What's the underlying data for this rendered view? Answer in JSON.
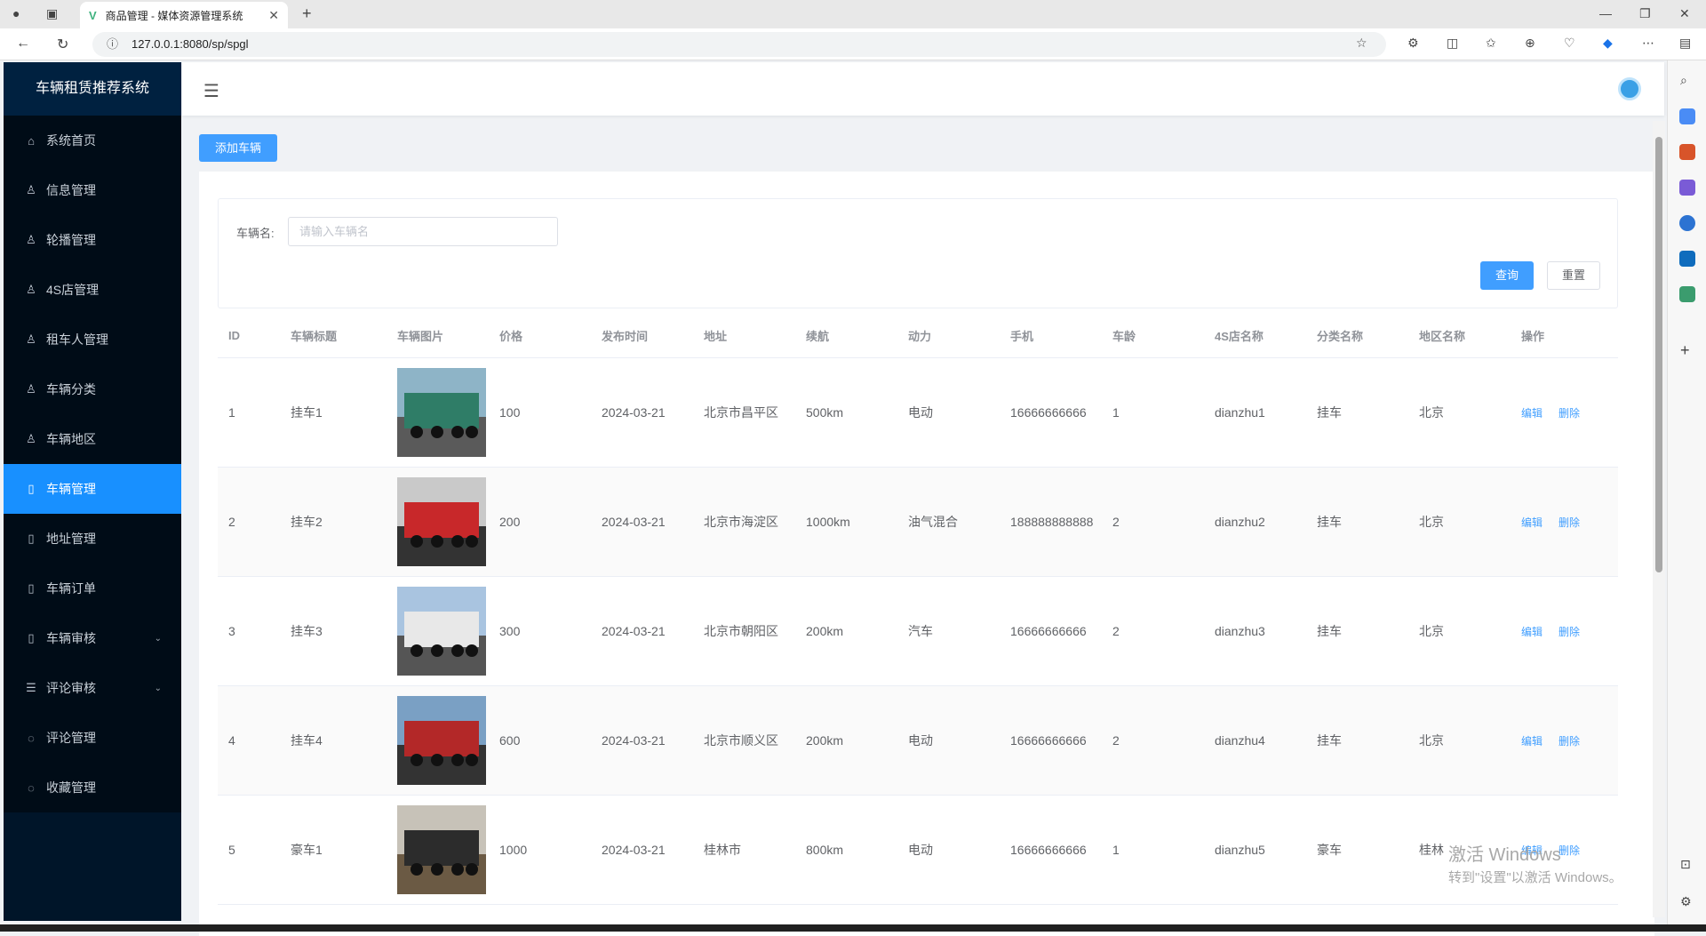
{
  "browser": {
    "tab_title": "商品管理 - 媒体资源管理系统",
    "url": "127.0.0.1:8080/sp/spgl"
  },
  "sidebar": {
    "brand": "车辆租赁推荐系统",
    "items": [
      {
        "label": "系统首页",
        "icon": "home-icon"
      },
      {
        "label": "信息管理",
        "icon": "user-icon"
      },
      {
        "label": "轮播管理",
        "icon": "user-icon"
      },
      {
        "label": "4S店管理",
        "icon": "user-icon"
      },
      {
        "label": "租车人管理",
        "icon": "user-icon"
      },
      {
        "label": "车辆分类",
        "icon": "user-icon"
      },
      {
        "label": "车辆地区",
        "icon": "user-icon"
      },
      {
        "label": "车辆管理",
        "icon": "document-icon"
      },
      {
        "label": "地址管理",
        "icon": "document-icon"
      },
      {
        "label": "车辆订单",
        "icon": "document-icon"
      },
      {
        "label": "车辆审核",
        "icon": "document-icon"
      },
      {
        "label": "评论审核",
        "icon": "list-icon"
      },
      {
        "label": "评论管理",
        "icon": "comment-icon"
      },
      {
        "label": "收藏管理",
        "icon": "comment-icon"
      }
    ],
    "active_index": 7
  },
  "toolbar": {
    "add_label": "添加车辆"
  },
  "search": {
    "label": "车辆名:",
    "placeholder": "请输入车辆名",
    "query_label": "查询",
    "reset_label": "重置"
  },
  "table": {
    "columns": [
      "ID",
      "车辆标题",
      "车辆图片",
      "价格",
      "发布时间",
      "地址",
      "续航",
      "动力",
      "手机",
      "车龄",
      "4S店名称",
      "分类名称",
      "地区名称",
      "操作"
    ],
    "edit_label": "编辑",
    "delete_label": "删除",
    "rows": [
      {
        "id": "1",
        "title": "挂车1",
        "price": "100",
        "date": "2024-03-21",
        "address": "北京市昌平区",
        "range": "500km",
        "power": "电动",
        "phone": "16666666666",
        "age": "1",
        "shop": "dianzhu1",
        "category": "挂车",
        "region": "北京"
      },
      {
        "id": "2",
        "title": "挂车2",
        "price": "200",
        "date": "2024-03-21",
        "address": "北京市海淀区",
        "range": "1000km",
        "power": "油气混合",
        "phone": "188888888888",
        "age": "2",
        "shop": "dianzhu2",
        "category": "挂车",
        "region": "北京"
      },
      {
        "id": "3",
        "title": "挂车3",
        "price": "300",
        "date": "2024-03-21",
        "address": "北京市朝阳区",
        "range": "200km",
        "power": "汽车",
        "phone": "16666666666",
        "age": "2",
        "shop": "dianzhu3",
        "category": "挂车",
        "region": "北京"
      },
      {
        "id": "4",
        "title": "挂车4",
        "price": "600",
        "date": "2024-03-21",
        "address": "北京市顺义区",
        "range": "200km",
        "power": "电动",
        "phone": "16666666666",
        "age": "2",
        "shop": "dianzhu4",
        "category": "挂车",
        "region": "北京"
      },
      {
        "id": "5",
        "title": "豪车1",
        "price": "1000",
        "date": "2024-03-21",
        "address": "桂林市",
        "range": "800km",
        "power": "电动",
        "phone": "16666666666",
        "age": "1",
        "shop": "dianzhu5",
        "category": "豪车",
        "region": "桂林"
      }
    ]
  },
  "watermark": {
    "line1": "激活 Windows",
    "line2": "转到\"设置\"以激活 Windows。"
  }
}
